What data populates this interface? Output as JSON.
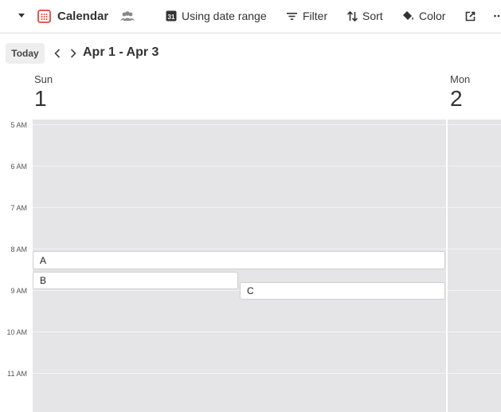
{
  "toolbar": {
    "view_name": "Calendar",
    "using_date_range_label": "Using date range",
    "calendar_day_glyph": "31",
    "filter_label": "Filter",
    "sort_label": "Sort",
    "color_label": "Color",
    "icons": [
      "chevron-down-icon",
      "calendar-icon",
      "people-icon",
      "calendar-31-icon",
      "filter-icon",
      "sort-icon",
      "paint-bucket-icon",
      "external-share-icon",
      "more-icon"
    ],
    "accent_color": "#e5433a"
  },
  "nav": {
    "today_label": "Today",
    "range_title": "Apr 1 - Apr 3"
  },
  "days": [
    {
      "name": "Sun",
      "num": "1"
    },
    {
      "name": "Mon",
      "num": "2"
    }
  ],
  "hours": [
    "5 AM",
    "6 AM",
    "7 AM",
    "8 AM",
    "9 AM",
    "10 AM",
    "11 AM"
  ],
  "events": [
    {
      "title": "A"
    },
    {
      "title": "B"
    },
    {
      "title": "C"
    }
  ],
  "colors": {
    "grid_background": "#e5e4e6",
    "event_background": "#ffffff",
    "today_button_background": "#eeeeee"
  }
}
